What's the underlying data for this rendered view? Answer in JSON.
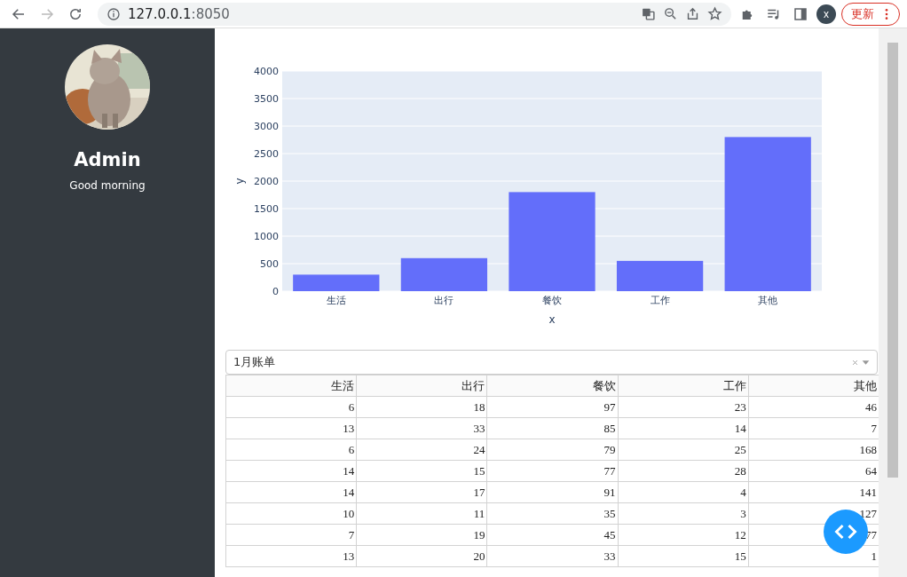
{
  "browser": {
    "forward_disabled": true,
    "url_host": "127.0.0.1",
    "url_port": ":8050",
    "profile_initial": "x",
    "update_label": "更新"
  },
  "sidebar": {
    "name": "Admin",
    "greeting": "Good morning"
  },
  "chart": {
    "chart_data": {
      "type": "bar",
      "xlabel": "x",
      "ylabel": "y",
      "categories": [
        "生活",
        "出行",
        "餐饮",
        "工作",
        "其他"
      ],
      "grid": true,
      "series": [
        {
          "color": "#636efa",
          "values": [
            300,
            600,
            1800,
            550,
            2800
          ]
        }
      ],
      "ylim": [
        0,
        4000
      ],
      "yticks": [
        0,
        500,
        1000,
        1500,
        2000,
        2500,
        3000,
        3500,
        4000
      ]
    }
  },
  "dropdown": {
    "value": "1月账单"
  },
  "table": {
    "columns": [
      "生活",
      "出行",
      "餐饮",
      "工作",
      "其他"
    ],
    "rows": [
      [
        "6",
        "18",
        "97",
        "23",
        "46"
      ],
      [
        "13",
        "33",
        "85",
        "14",
        "7"
      ],
      [
        "6",
        "24",
        "79",
        "25",
        "168"
      ],
      [
        "14",
        "15",
        "77",
        "28",
        "64"
      ],
      [
        "14",
        "17",
        "91",
        "4",
        "141"
      ],
      [
        "10",
        "11",
        "35",
        "3",
        "127"
      ],
      [
        "7",
        "19",
        "45",
        "12",
        "77"
      ],
      [
        "13",
        "20",
        "33",
        "15",
        "1"
      ]
    ]
  }
}
